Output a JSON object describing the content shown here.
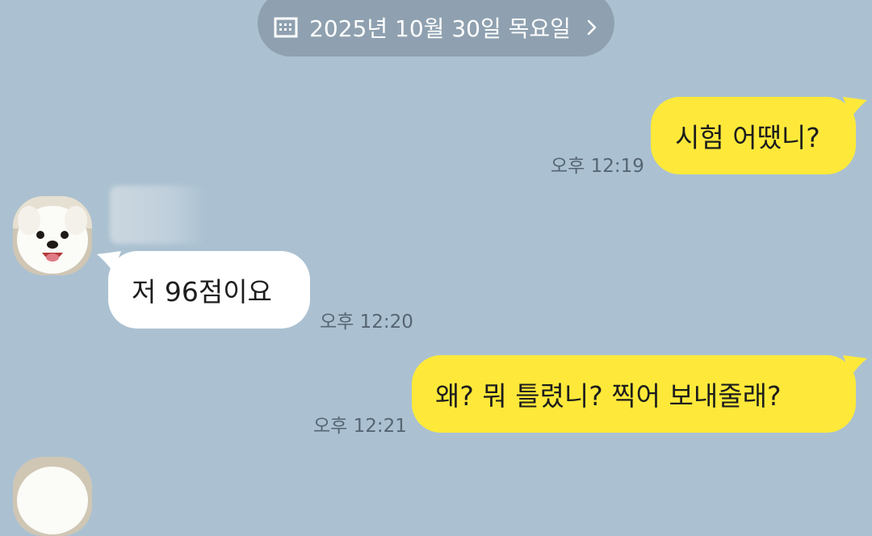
{
  "date_header": {
    "label": "2025년 10월 30일 목요일",
    "icon": "calendar-icon",
    "chevron_icon": "chevron-right-icon"
  },
  "colors": {
    "background": "#abc1d1",
    "mine_bubble": "#fee93a",
    "theirs_bubble": "#ffffff",
    "date_pill": "#8fa1b0",
    "timestamp": "#566573"
  },
  "messages": [
    {
      "from": "me",
      "text": "시험 어땠니?",
      "time": "오후 12:19"
    },
    {
      "from": "other",
      "sender": "",
      "text": "저 96점이요",
      "time": "오후 12:20"
    },
    {
      "from": "me",
      "text": "왜?  뭐 틀렸니?  찍어 보내줄래?",
      "time": "오후 12:21"
    }
  ]
}
